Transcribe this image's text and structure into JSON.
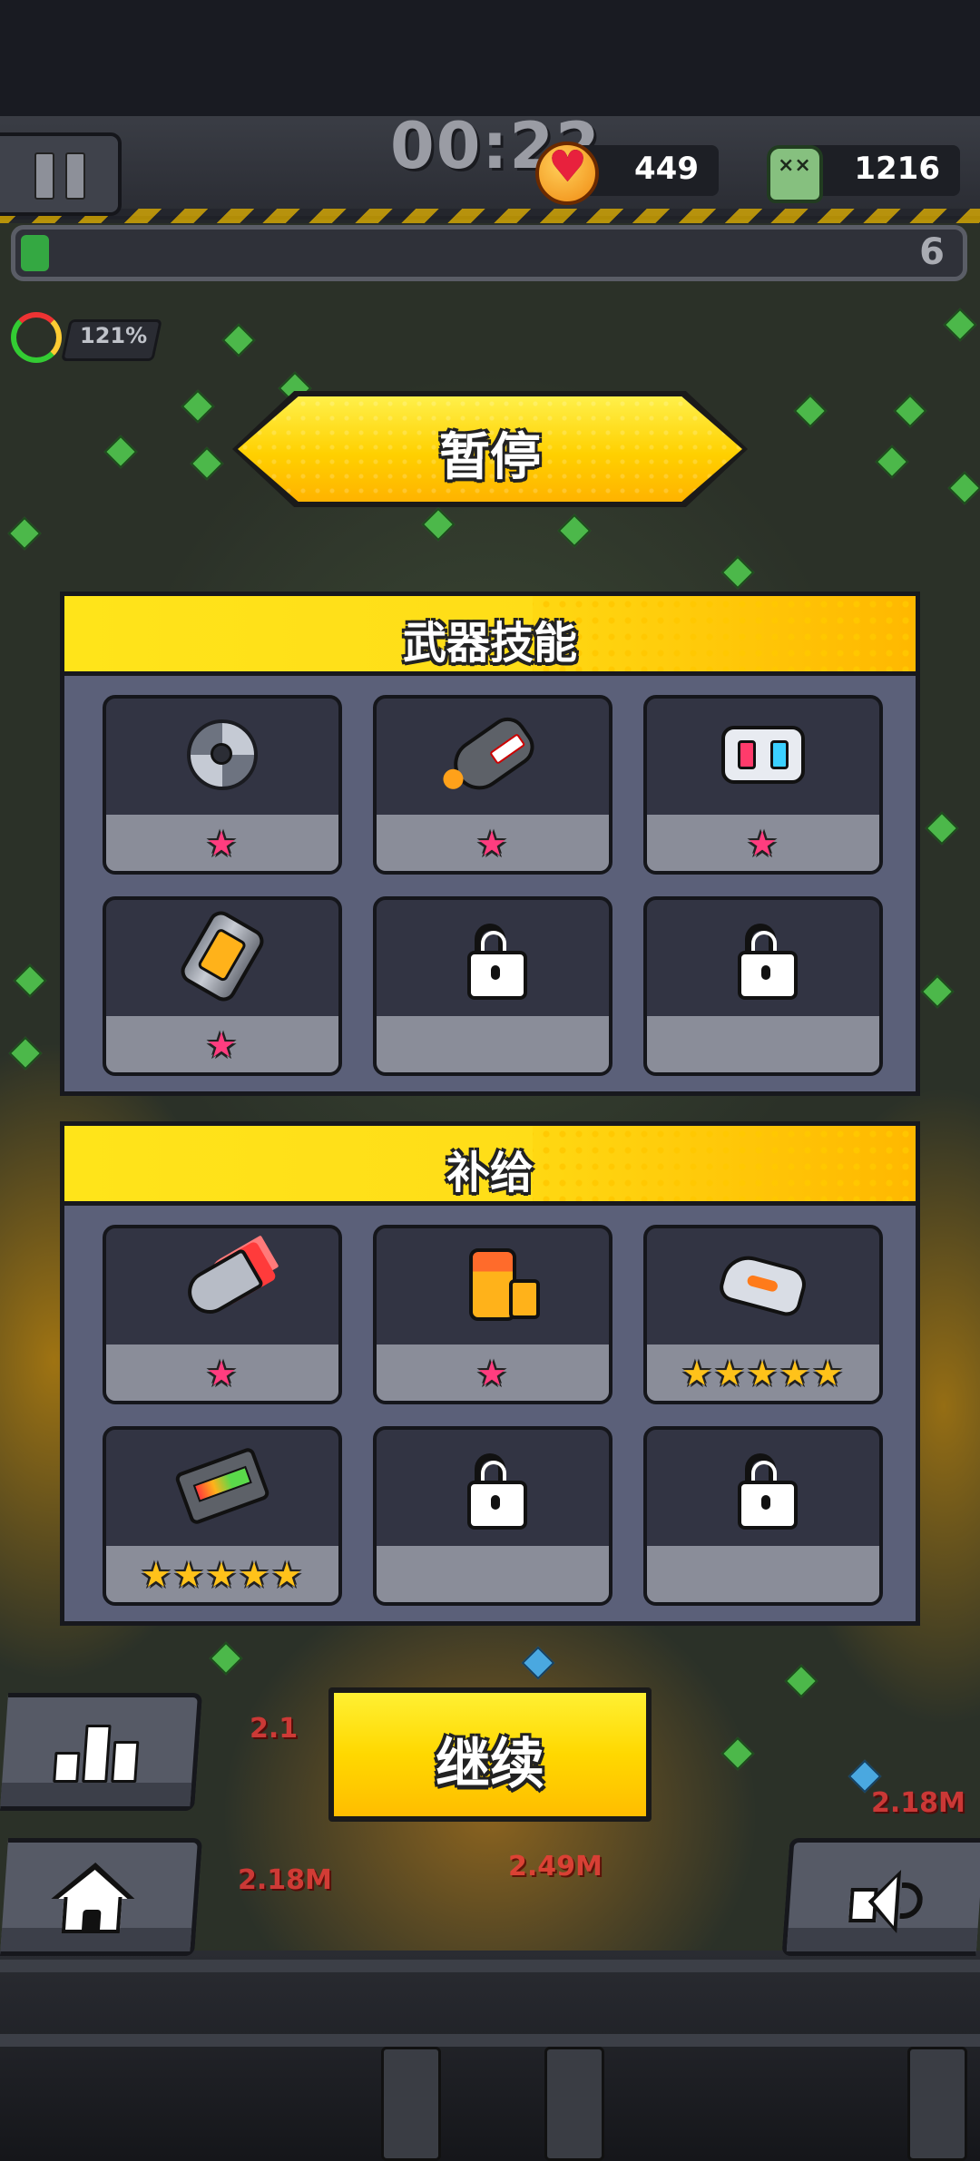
{
  "hud": {
    "timer": "00:22",
    "hearts": "449",
    "kills": "1216",
    "level": "6",
    "xp_progress": 0.03,
    "speed": "121%"
  },
  "pause_title": "暂停",
  "weapons": {
    "title": "武器技能",
    "slots": [
      {
        "icon": "shuriken-icon",
        "stars": "★",
        "locked": false
      },
      {
        "icon": "shark-missile-icon",
        "stars": "★",
        "locked": false
      },
      {
        "icon": "robot-drone-icon",
        "stars": "★",
        "locked": false
      },
      {
        "icon": "canister-icon",
        "stars": "★",
        "locked": false
      },
      {
        "icon": "lock-icon",
        "stars": "",
        "locked": true
      },
      {
        "icon": "lock-icon",
        "stars": "",
        "locked": true
      }
    ]
  },
  "supplies": {
    "title": "补给",
    "slots": [
      {
        "icon": "flaming-bullet-icon",
        "stars": "★",
        "star_color": "pink",
        "locked": false
      },
      {
        "icon": "battery-icon",
        "stars": "★",
        "star_color": "pink",
        "locked": false
      },
      {
        "icon": "sneaker-icon",
        "stars": "★★★★★",
        "star_color": "gold",
        "locked": false
      },
      {
        "icon": "power-module-icon",
        "stars": "★★★★★",
        "star_color": "gold",
        "locked": false
      },
      {
        "icon": "lock-icon",
        "stars": "",
        "locked": true
      },
      {
        "icon": "lock-icon",
        "stars": "",
        "locked": true
      }
    ]
  },
  "continue_label": "继续",
  "buttons": {
    "stats": "stats-bars-icon",
    "home": "home-icon",
    "sound": "speaker-icon"
  },
  "colors": {
    "accent_yellow": "#ffd800",
    "panel_bg": "#5b6079",
    "slot_bg": "#323443",
    "star_pink": "#ff3d7f",
    "star_gold": "#ffc21a"
  },
  "background_damage_numbers": [
    "2.18M",
    "2.18M",
    "2.1",
    "2.18M",
    "2.49M"
  ]
}
